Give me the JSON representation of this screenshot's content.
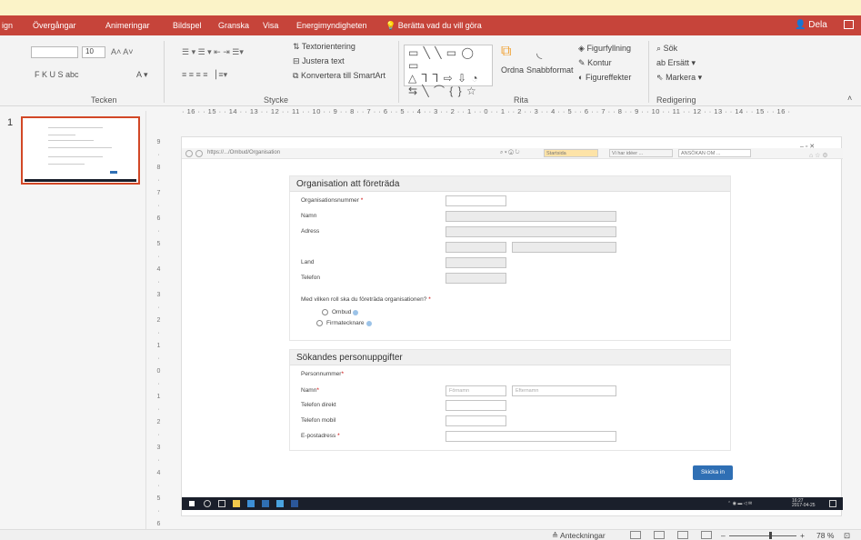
{
  "tabs": {
    "design": "ign",
    "transitions": "Övergångar",
    "animations": "Animeringar",
    "slideshow": "Bildspel",
    "review": "Granska",
    "view": "Visa",
    "energy": "Energimyndigheten",
    "tell_me": "Berätta vad du vill göra",
    "share": "Dela"
  },
  "ribbon": {
    "font_size": "10",
    "text_direction": "Textorientering",
    "align_text": "Justera text",
    "convert_smartart": "Konvertera till SmartArt",
    "arrange": "Ordna",
    "quick_styles": "Snabbformat",
    "shape_fill": "Figurfyllning",
    "outline": "Kontur",
    "shape_effects": "Figureffekter",
    "find": "Sök",
    "replace": "Ersätt",
    "select": "Markera",
    "font_buttons": "F  K  U  S  abc",
    "groups": {
      "font": "Tecken",
      "paragraph": "Stycke",
      "drawing": "Rita",
      "editing": "Redigering"
    }
  },
  "ruler": "· 16 · · 15 · · 14 · · 13 · · 12 · · 11 · · 10 · · 9 · · 8 · · 7 · · 6 · · 5 · · 4 · · 3 · · 2 · · 1 · · 0 · · 1 · · 2 · · 3 · · 4 · · 5 · · 6 · · 7 · · 8 · · 9 · · 10 · · 11 · · 12 · · 13 · · 14 · · 15 · · 16 ·",
  "slide_number": "1",
  "browser": {
    "url": "https://.../Ombud/Organisation",
    "tab1": "Startsida",
    "tab2": "Vi har idéer ...",
    "tab3": "ANSÖKAN OM ..."
  },
  "form": {
    "section1_title": "Organisation att företräda",
    "org_number": "Organisationsnummer",
    "name": "Namn",
    "address": "Adress",
    "country": "Land",
    "phone": "Telefon",
    "role_question": "Med vilken roll ska du företräda organisationen?",
    "role_ombud": "Ombud",
    "role_firmatecknare": "Firmatecknare",
    "section2_title": "Sökandes personuppgifter",
    "personal_number": "Personnummer",
    "name2": "Namn",
    "first_name_placeholder": "Förnamn",
    "last_name_placeholder": "Efternamn",
    "phone_direct": "Telefon direkt",
    "phone_mobile": "Telefon mobil",
    "email": "E-postadress",
    "submit": "Skicka in",
    "required_mark": "*"
  },
  "taskbar": {
    "time": "16:27",
    "date": "2017-04-25"
  },
  "status": {
    "notes": "Anteckningar",
    "zoom": "78 %"
  }
}
